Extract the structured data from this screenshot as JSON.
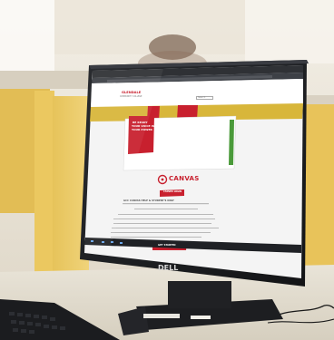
{
  "logo": {
    "name": "GLENDALE",
    "sub": "COMMUNITY COLLEGE"
  },
  "search": {
    "placeholder": "Search"
  },
  "promo": {
    "lines": [
      "BE READY",
      "YOUR VOICE IS",
      "YOUR POWER"
    ]
  },
  "canvas": {
    "wordmark": "CANVAS",
    "button_label": "CANVAS LOGIN"
  },
  "page": {
    "heading": "GCC CANVAS HELP & STUDENT'S ONLY",
    "bottom_button": "GET STARTED"
  },
  "monitor": {
    "brand": "DELL"
  },
  "colors": {
    "accent_red": "#c8202e",
    "nav_yellow": "#d8b63a",
    "cubicle_yellow": "#e9c95c"
  }
}
